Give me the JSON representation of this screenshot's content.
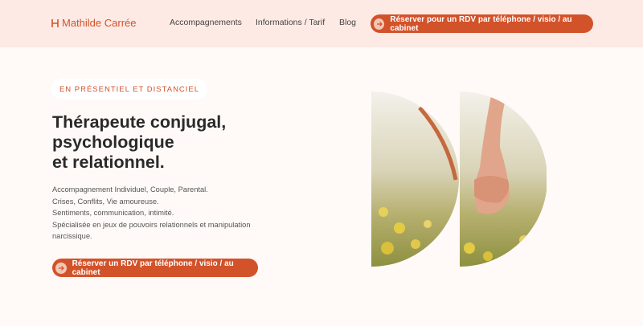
{
  "header": {
    "logo_text": "Mathilde Carrée",
    "nav": [
      "Accompagnements",
      "Informations / Tarif",
      "Blog"
    ],
    "cta_label": "Réserver pour un RDV par téléphone / visio / au cabinet"
  },
  "hero": {
    "badge": "EN PRÉSENTIEL ET DISTANCIEL",
    "title_lines": [
      "Thérapeute conjugal,",
      "psychologique",
      "et relationnel."
    ],
    "description_lines": [
      "Accompagnement Individuel, Couple, Parental.",
      "Crises, Conflits, Vie amoureuse.",
      "Sentiments, communication, intimité.",
      "Spécialisée en jeux de pouvoirs relationnels et manipulation",
      "narcissique."
    ],
    "cta_label": "Réserver un RDV par téléphone / visio / au cabinet"
  },
  "colors": {
    "accent": "#d2522a",
    "header_bg": "#fdeae4",
    "page_bg": "#fffaf7"
  },
  "icons": {
    "logo": "logo-mark-icon",
    "cta": "arrow-right-icon",
    "hero_image": "holding-hands-photo"
  }
}
